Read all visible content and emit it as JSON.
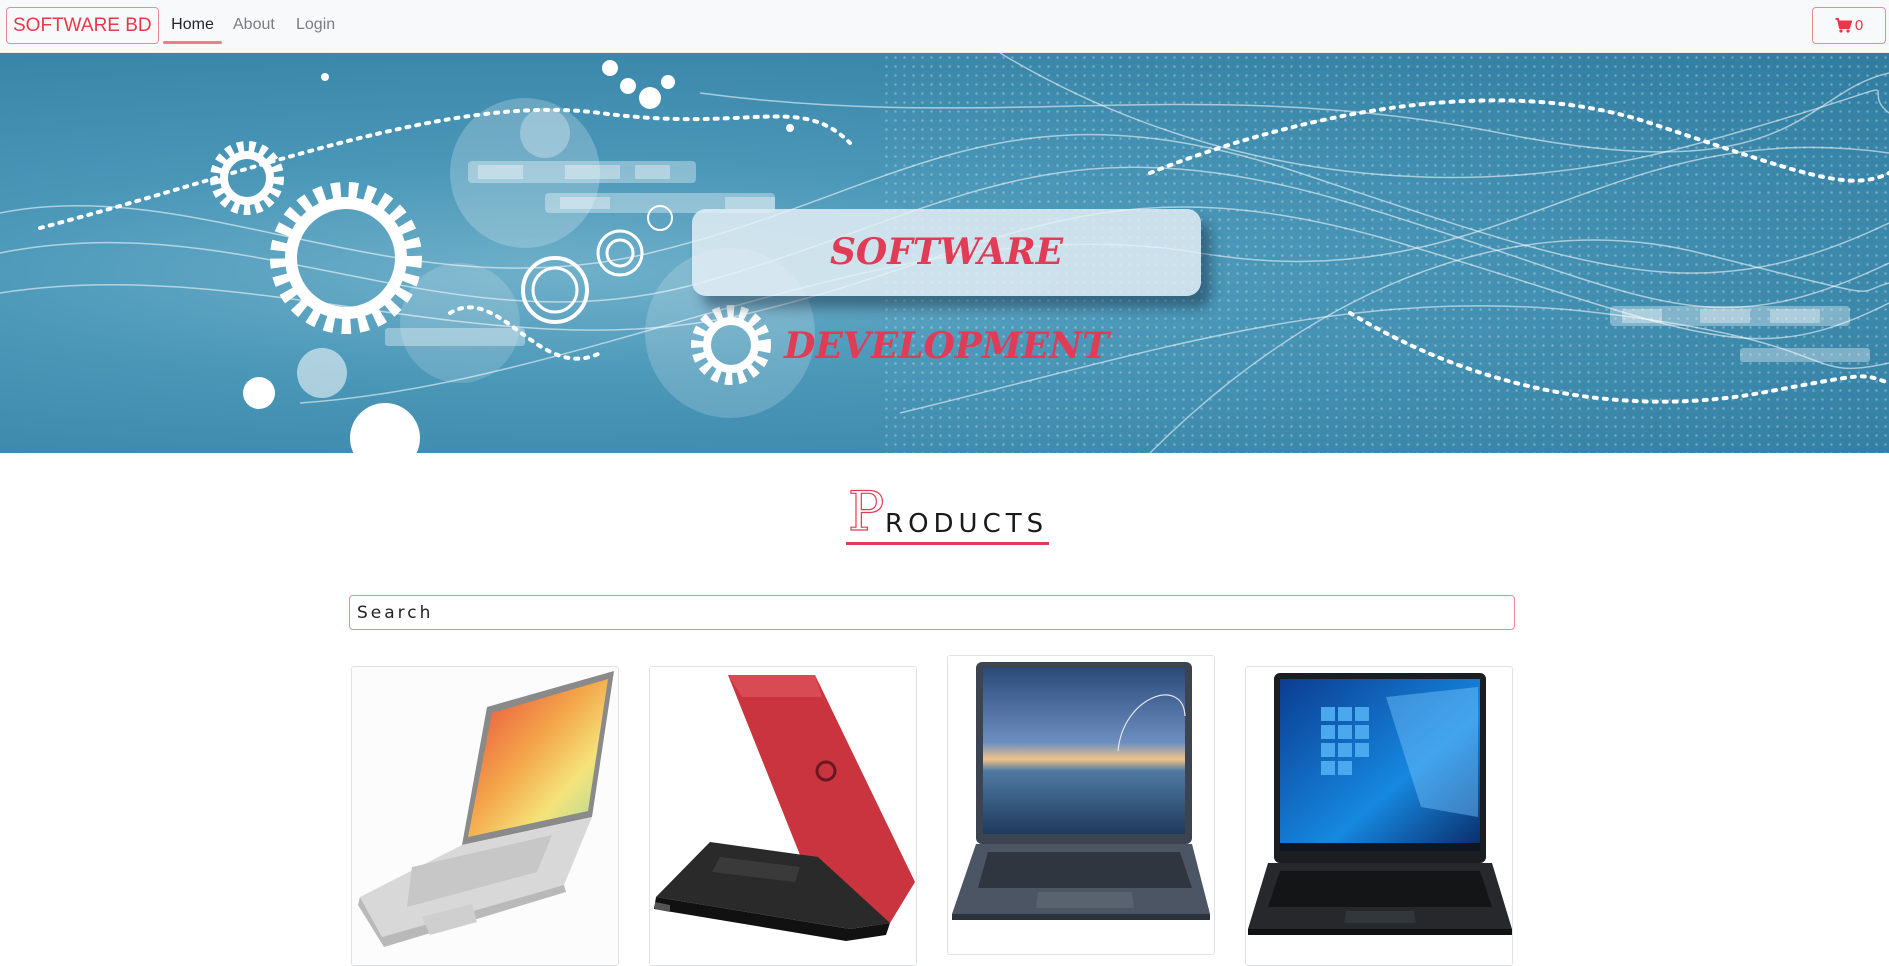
{
  "nav": {
    "brand": "SOFTWARE BD",
    "links": [
      {
        "label": "Home",
        "active": true
      },
      {
        "label": "About",
        "active": false
      },
      {
        "label": "Login",
        "active": false
      }
    ],
    "cart": {
      "icon": "shopping-cart-icon",
      "count": "0"
    }
  },
  "hero": {
    "title": "SOFTWARE DEVELOPMENT"
  },
  "products": {
    "heading_initial": "P",
    "heading_rest": "RODUCTS",
    "search_placeholder": "Search",
    "items": [
      {
        "image": "laptop-silver-vivobook"
      },
      {
        "image": "laptop-red-dell"
      },
      {
        "image": "laptop-zenbook"
      },
      {
        "image": "laptop-acer"
      }
    ]
  },
  "colors": {
    "accent": "#e8384b",
    "accent_light": "#f08a94",
    "navbar_bg": "#f8f9fa",
    "hero_bg": "#3b88ab"
  }
}
